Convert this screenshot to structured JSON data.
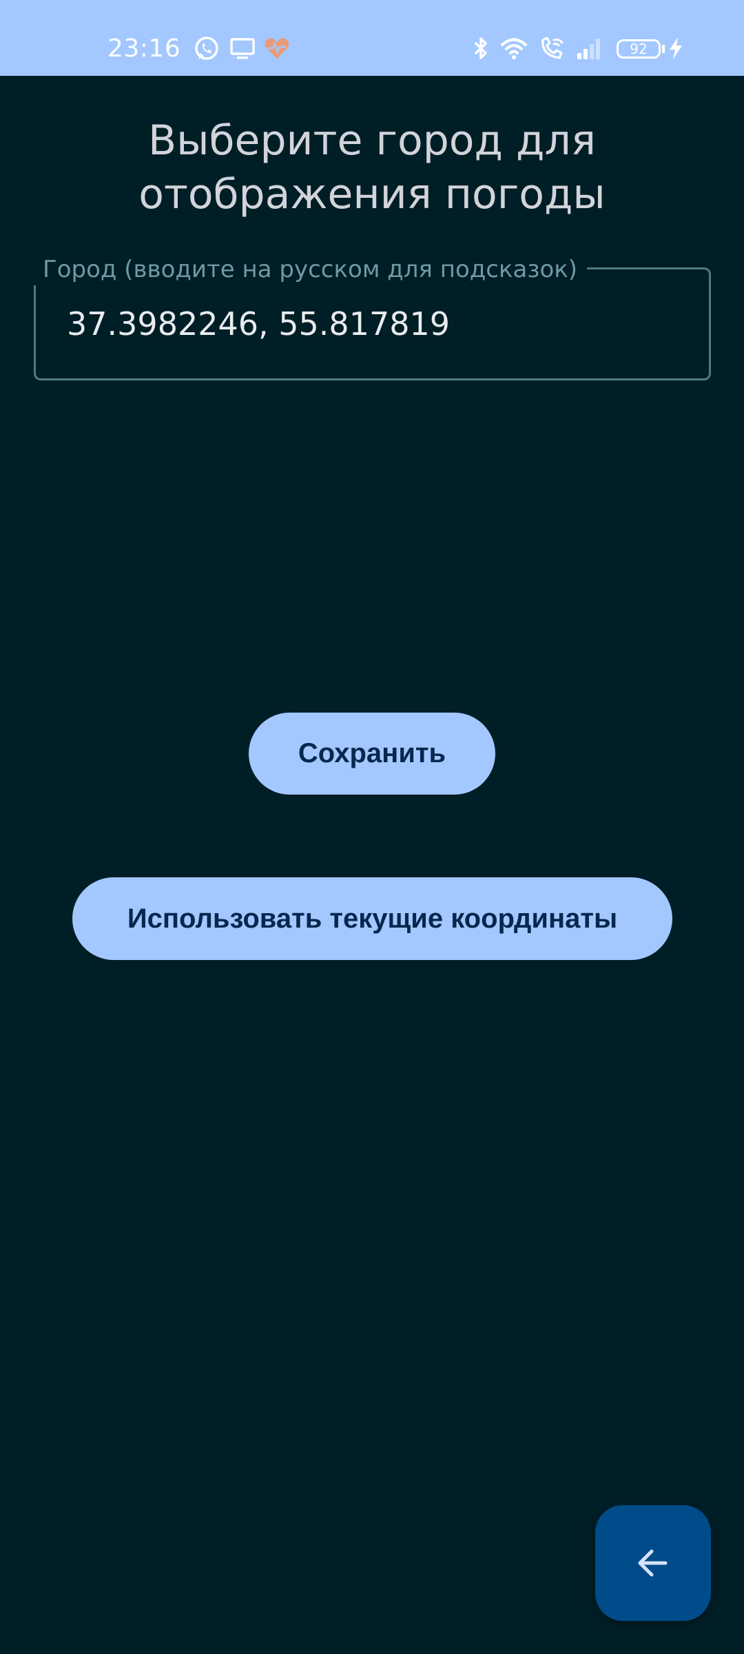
{
  "status_bar": {
    "time": "23:16",
    "battery_level": "92",
    "background_color": "#a3c8ff",
    "left_icons": [
      "whatsapp-icon",
      "screen-cast-icon",
      "health-heart-icon"
    ],
    "right_icons": [
      "bluetooth-icon",
      "wifi-icon",
      "wifi-calling-icon",
      "signal-icon",
      "battery-icon",
      "charging-icon"
    ]
  },
  "main": {
    "title": "Выберите город для отображения погоды",
    "city_field": {
      "label": "Город (вводите на русском для подсказок)",
      "value": "37.3982246, 55.817819"
    },
    "save_button_label": "Сохранить",
    "use_coords_button_label": "Использовать текущие координаты"
  },
  "fab": {
    "icon": "arrow-back-icon"
  },
  "colors": {
    "background": "#001e26",
    "accent": "#a3c8ff",
    "button_text": "#06284e",
    "fab_background": "#004c8a",
    "field_border": "#4f7b83",
    "label": "#6f9aa2"
  }
}
